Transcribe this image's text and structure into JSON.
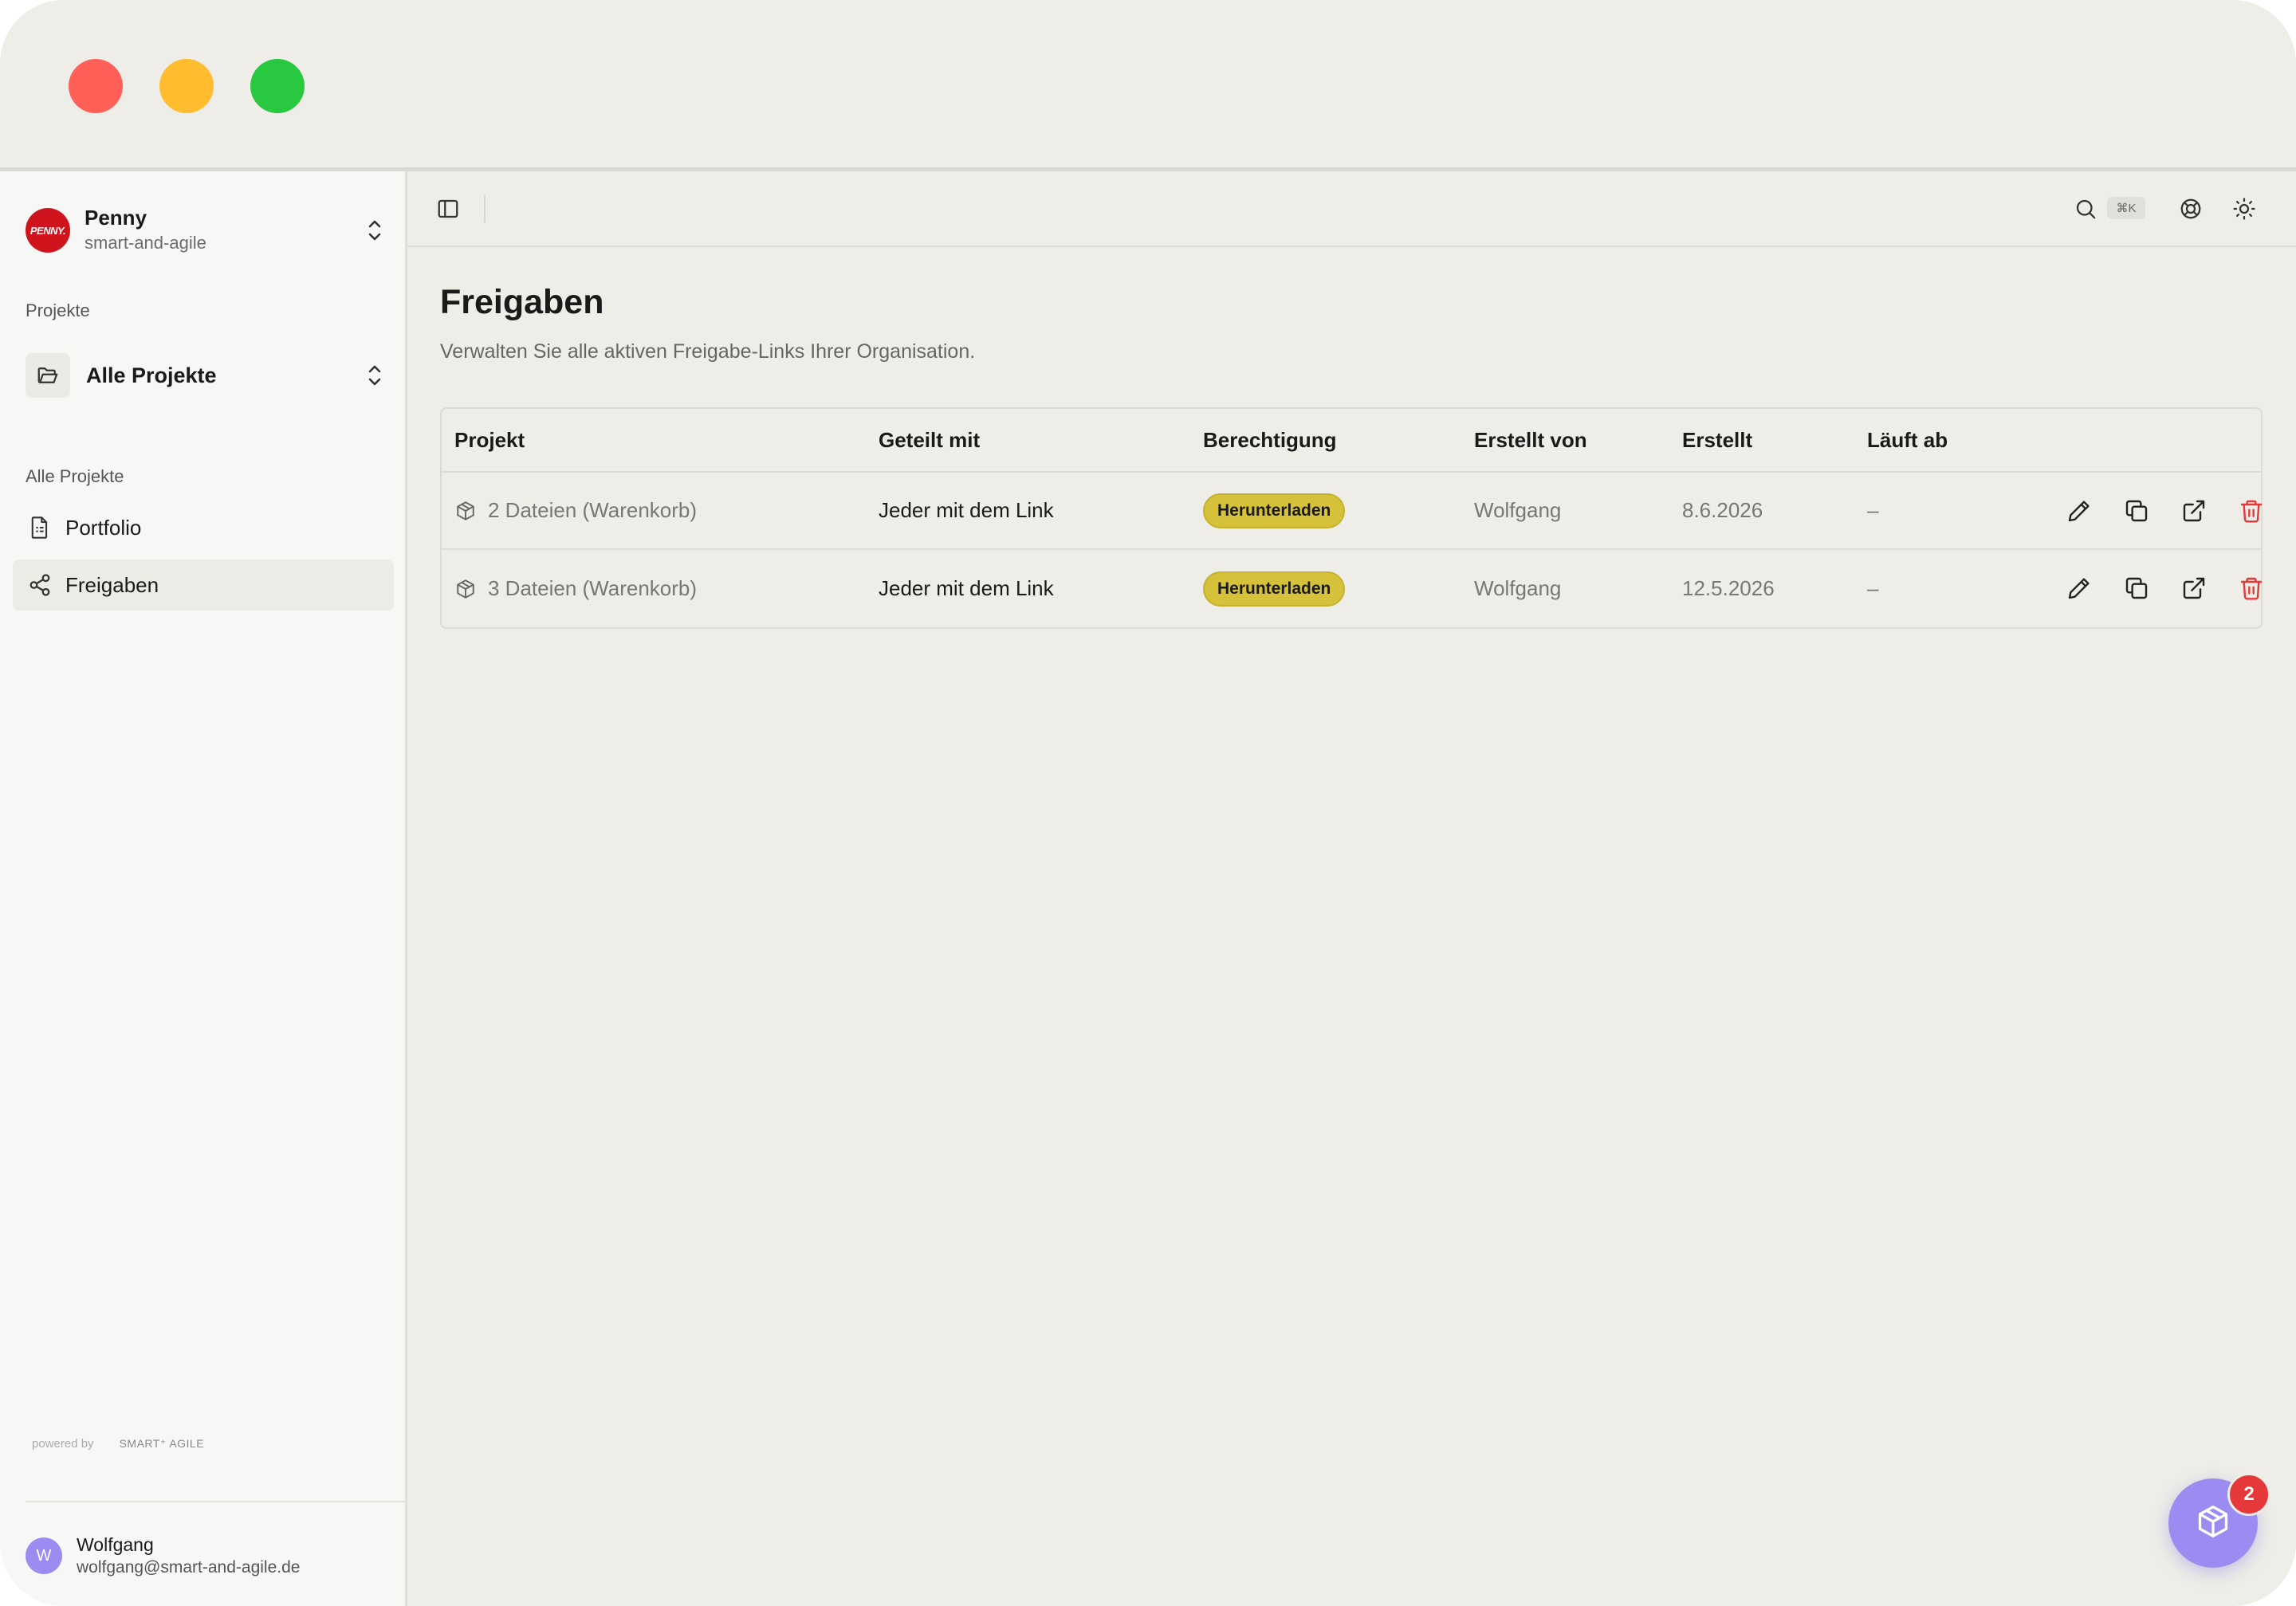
{
  "sidebar": {
    "org": {
      "name": "Penny",
      "slug": "smart-and-agile",
      "logo_text": "PENNY."
    },
    "projects_label": "Projekte",
    "project_select": "Alle Projekte",
    "nav_section_label": "Alle Projekte",
    "nav_items": [
      {
        "label": "Portfolio",
        "icon": "document-icon"
      },
      {
        "label": "Freigaben",
        "icon": "share-icon",
        "active": true
      }
    ],
    "powered_by": "powered by",
    "powered_brand": "SMART⁺ AGILE",
    "user": {
      "initial": "W",
      "name": "Wolfgang",
      "email": "wolfgang@smart-and-agile.de"
    }
  },
  "toolbar": {
    "shortcut": "⌘K",
    "icons": [
      "sidebar-toggle-icon",
      "search-icon",
      "help-icon",
      "sun-icon"
    ]
  },
  "page": {
    "title": "Freigaben",
    "subtitle": "Verwalten Sie alle aktiven Freigabe-Links Ihrer Organisation."
  },
  "table": {
    "headers": [
      "Projekt",
      "Geteilt mit",
      "Berechtigung",
      "Erstellt von",
      "Erstellt",
      "Läuft ab"
    ],
    "rows": [
      {
        "projekt": "2 Dateien (Warenkorb)",
        "geteilt": "Jeder mit dem Link",
        "berechtigung": "Herunterladen",
        "erstellt_von": "Wolfgang",
        "erstellt": "8.6.2026",
        "laeuft_ab": "–"
      },
      {
        "projekt": "3 Dateien (Warenkorb)",
        "geteilt": "Jeder mit dem Link",
        "berechtigung": "Herunterladen",
        "erstellt_von": "Wolfgang",
        "erstellt": "12.5.2026",
        "laeuft_ab": "–"
      }
    ]
  },
  "fab": {
    "badge_count": "2",
    "icon": "package-icon"
  },
  "colors": {
    "accent": "#9b8cf2",
    "badge": "#d6c23a",
    "danger": "#e5383b",
    "brand": "#d0141d"
  }
}
